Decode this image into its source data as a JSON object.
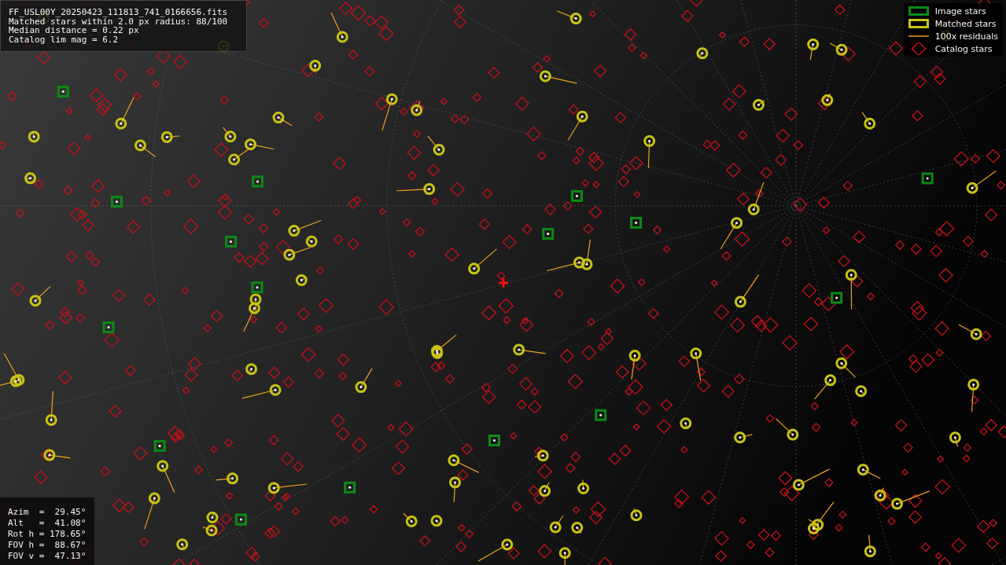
{
  "info": {
    "lines": [
      "FF_USL00Y_20250423_111813_741_0166656.fits",
      "Matched stars within 2.0 px radius: 88/100",
      "Median distance = 0.22 px",
      "Catalog lim mag = 6.2"
    ]
  },
  "legend": [
    {
      "kind": "image",
      "label": "Image stars"
    },
    {
      "kind": "matched",
      "label": "Matched stars"
    },
    {
      "kind": "residual",
      "label": "100x residuals"
    },
    {
      "kind": "catalog",
      "label": "Catalog stars"
    }
  ],
  "pointing": {
    "lines": [
      "Azim  =  29.45°",
      "Alt   =  41.08°",
      "Rot h = 178.65°",
      "FOV h =  88.67°",
      "FOV v =  47.13°"
    ]
  }
}
